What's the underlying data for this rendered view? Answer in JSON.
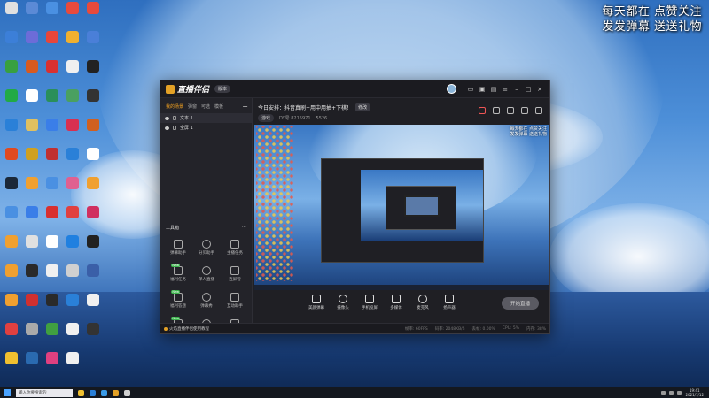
{
  "overlay": {
    "line1": "每天都在 点赞关注",
    "line2": "发发弹幕 送送礼物"
  },
  "desktop_icons": [
    {
      "label": "",
      "color": "#e0e0e0"
    },
    {
      "label": "",
      "color": "#5b8ad6"
    },
    {
      "label": "",
      "color": "#4a90e2"
    },
    {
      "label": "",
      "color": "#e84a3c"
    },
    {
      "label": "",
      "color": "#e84a3c"
    },
    {
      "label": "",
      "color": "#3c7fd8"
    },
    {
      "label": "",
      "color": "#6c6cd8"
    },
    {
      "label": "",
      "color": "#e8463a"
    },
    {
      "label": "",
      "color": "#f0b030"
    },
    {
      "label": "",
      "color": "#4a7fd8"
    },
    {
      "label": "",
      "color": "#38a040"
    },
    {
      "label": "",
      "color": "#d85a20"
    },
    {
      "label": "",
      "color": "#d83030"
    },
    {
      "label": "",
      "color": "#f0f0f0"
    },
    {
      "label": "",
      "color": "#222"
    },
    {
      "label": "",
      "color": "#22aa44"
    },
    {
      "label": "",
      "color": "#ffffff"
    },
    {
      "label": "",
      "color": "#2a8f5a"
    },
    {
      "label": "",
      "color": "#4aa060"
    },
    {
      "label": "",
      "color": "#333"
    },
    {
      "label": "",
      "color": "#2a80d8"
    },
    {
      "label": "",
      "color": "#e0c060"
    },
    {
      "label": "",
      "color": "#3a7ee8"
    },
    {
      "label": "",
      "color": "#d83050"
    },
    {
      "label": "",
      "color": "#d06020"
    },
    {
      "label": "",
      "color": "#e04a20"
    },
    {
      "label": "",
      "color": "#d0a020"
    },
    {
      "label": "",
      "color": "#c03030"
    },
    {
      "label": "",
      "color": "#2a80d8"
    },
    {
      "label": "",
      "color": "#ffffff"
    },
    {
      "label": "",
      "color": "#1b2838"
    },
    {
      "label": "",
      "color": "#f0a030"
    },
    {
      "label": "",
      "color": "#4a90e2"
    },
    {
      "label": "",
      "color": "#e06090"
    },
    {
      "label": "",
      "color": "#f0a030"
    },
    {
      "label": "",
      "color": "#4a90e2"
    },
    {
      "label": "",
      "color": "#3a7ee8"
    },
    {
      "label": "",
      "color": "#d83030"
    },
    {
      "label": "",
      "color": "#e04040"
    },
    {
      "label": "",
      "color": "#d03060"
    },
    {
      "label": "",
      "color": "#f0a030"
    },
    {
      "label": "",
      "color": "#e0e0e0"
    },
    {
      "label": "",
      "color": "#ffffff"
    },
    {
      "label": "",
      "color": "#2080e0"
    },
    {
      "label": "",
      "color": "#222"
    },
    {
      "label": "",
      "color": "#f0a030"
    },
    {
      "label": "",
      "color": "#2a2a2a"
    },
    {
      "label": "",
      "color": "#f0f0f0"
    },
    {
      "label": "",
      "color": "#d0d0d0"
    },
    {
      "label": "",
      "color": "#3a5fa8"
    },
    {
      "label": "",
      "color": "#f0a030"
    },
    {
      "label": "",
      "color": "#d03030"
    },
    {
      "label": "",
      "color": "#2a2a2a"
    },
    {
      "label": "",
      "color": "#2a80d8"
    },
    {
      "label": "",
      "color": "#f0f0f0"
    },
    {
      "label": "",
      "color": "#e04040"
    },
    {
      "label": "",
      "color": "#aaa"
    },
    {
      "label": "",
      "color": "#40a040"
    },
    {
      "label": "",
      "color": "#f0f0f0"
    },
    {
      "label": "",
      "color": "#333"
    },
    {
      "label": "",
      "color": "#f0c030"
    },
    {
      "label": "",
      "color": "#2a6ab0"
    },
    {
      "label": "",
      "color": "#e04080"
    },
    {
      "label": "",
      "color": "#f0f0f0"
    }
  ],
  "app": {
    "name": "直播伴侣",
    "version": "版本",
    "tabs": [
      "我的场景",
      "弹窗",
      "可选",
      "模板"
    ],
    "scenes": [
      "文本 1",
      "全屏 1"
    ],
    "toolbox_title": "工具箱",
    "tools": [
      {
        "label": "弹幕助手",
        "badge": ""
      },
      {
        "label": "分贝助手",
        "badge": ""
      },
      {
        "label": "主播任务",
        "badge": ""
      },
      {
        "label": "福利任务",
        "badge": "New"
      },
      {
        "label": "单人直播",
        "badge": ""
      },
      {
        "label": "连屏管",
        "badge": ""
      },
      {
        "label": "福利答题",
        "badge": "New"
      },
      {
        "label": "弹幕秀",
        "badge": ""
      },
      {
        "label": "互动助手",
        "badge": ""
      },
      {
        "label": "",
        "badge": "New"
      },
      {
        "label": "",
        "badge": ""
      },
      {
        "label": "",
        "badge": ""
      }
    ],
    "live_title": "今日安排：抖音真刷+用中用抽+下棋！",
    "edit_label": "修改",
    "category": "游戏",
    "uid": "DY号 8215971",
    "hot": "5526",
    "preview_overlay": [
      "每天都在 点赞关注",
      "发发弹幕 送送礼物"
    ],
    "controls": [
      "美颜弹幕",
      "摄像头",
      "手机投屏",
      "多媒体",
      "麦克风",
      "扬声器"
    ],
    "start_label": "开始直播",
    "tip": "火焰直播伴侣使用教程",
    "stats": [
      "帧率: 60FPS",
      "码率: 2048KB/S",
      "丢帧: 0.00%",
      "CPU: 5%",
      "内存: 38%"
    ]
  },
  "taskbar": {
    "search_placeholder": "输入你要搜索的",
    "time": "19:41",
    "date": "2021/7/12"
  }
}
